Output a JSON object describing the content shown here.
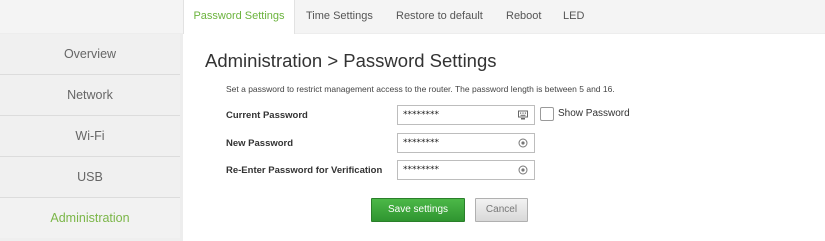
{
  "tabs": [
    {
      "label": "Password Settings",
      "active": true
    },
    {
      "label": "Time Settings",
      "active": false
    },
    {
      "label": "Restore to default",
      "active": false
    },
    {
      "label": "Reboot",
      "active": false
    },
    {
      "label": "LED",
      "active": false
    }
  ],
  "sidebar": {
    "items": [
      {
        "label": "Overview",
        "active": false
      },
      {
        "label": "Network",
        "active": false
      },
      {
        "label": "Wi-Fi",
        "active": false
      },
      {
        "label": "USB",
        "active": false
      },
      {
        "label": "Administration",
        "active": true
      }
    ]
  },
  "main": {
    "title": "Administration > Password Settings",
    "description": "Set a password to restrict management access to the router. The password length is between 5 and 16.",
    "fields": {
      "current": {
        "label": "Current Password",
        "value": "********",
        "icon": "keyboard-icon"
      },
      "new": {
        "label": "New Password",
        "value": "********",
        "icon": "eye-icon"
      },
      "reenter": {
        "label": "Re-Enter Password for Verification",
        "value": "********",
        "icon": "eye-icon"
      }
    },
    "show_password": {
      "label": "Show Password",
      "checked": false
    },
    "save_label": "Save settings",
    "cancel_label": "Cancel"
  },
  "colors": {
    "accent": "#6bb33d",
    "save_button": "#3aa63a"
  }
}
